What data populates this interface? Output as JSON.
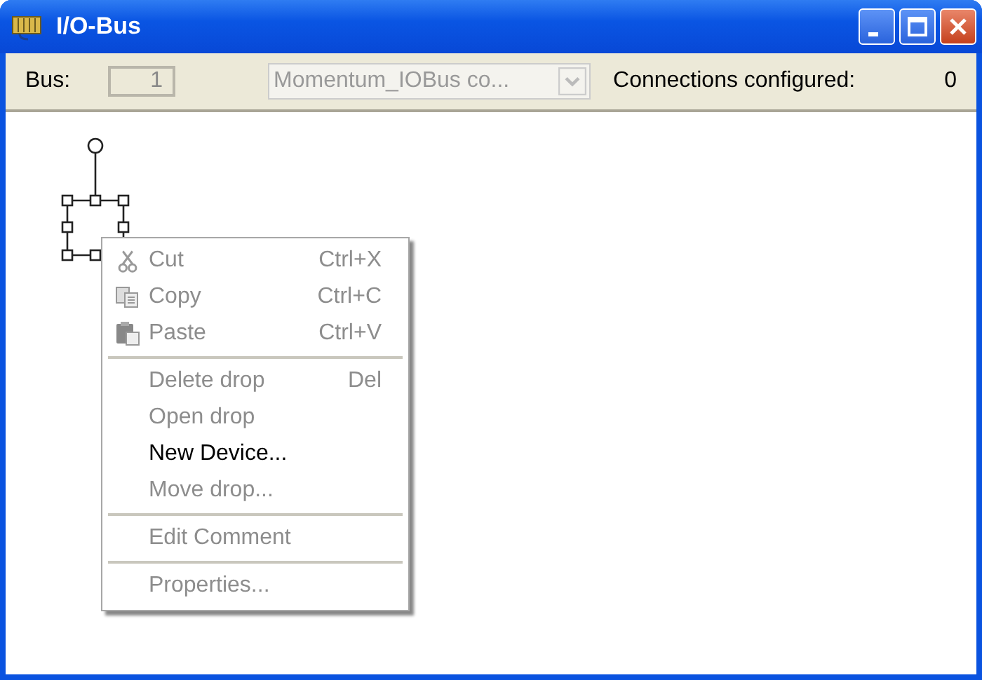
{
  "window": {
    "title": "I/O-Bus"
  },
  "toolbar": {
    "bus_label": "Bus:",
    "bus_value": "1",
    "bus_disabled": true,
    "module": "Momentum_IOBus co...",
    "module_disabled": true,
    "connections_label": "Connections configured:",
    "connections_value": "0"
  },
  "context_menu": {
    "sections": [
      [
        {
          "label": "Cut",
          "shortcut": "Ctrl+X",
          "disabled": true
        },
        {
          "label": "Copy",
          "shortcut": "Ctrl+C",
          "disabled": true
        },
        {
          "label": "Paste",
          "shortcut": "Ctrl+V",
          "disabled": true
        }
      ],
      [
        {
          "label": "Delete drop",
          "shortcut": "Del",
          "disabled": true
        },
        {
          "label": "Open drop",
          "disabled": true
        },
        {
          "label": "New Device...",
          "disabled": false
        },
        {
          "label": "Move drop...",
          "disabled": true
        }
      ],
      [
        {
          "label": "Edit Comment",
          "disabled": true
        }
      ],
      [
        {
          "label": "Properties...",
          "disabled": true
        }
      ]
    ]
  }
}
